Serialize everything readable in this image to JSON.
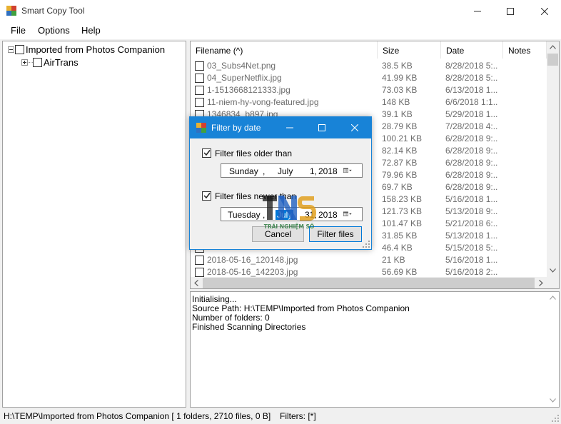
{
  "window": {
    "title": "Smart Copy Tool"
  },
  "menu": [
    "File",
    "Options",
    "Help"
  ],
  "tree": {
    "items": [
      {
        "label": "Imported from Photos Companion",
        "expanded": true
      },
      {
        "label": "AirTrans",
        "expanded": false
      }
    ]
  },
  "list": {
    "columns": [
      "Filename (^)",
      "Size",
      "Date",
      "Notes"
    ],
    "rows": [
      {
        "name": "03_Subs4Net.png",
        "size": "38.5 KB",
        "date": "8/28/2018 5:..."
      },
      {
        "name": "04_SuperNetflix.jpg",
        "size": "41.99 KB",
        "date": "8/28/2018 5:..."
      },
      {
        "name": "1-1513668121333.jpg",
        "size": "73.03 KB",
        "date": "6/13/2018 1..."
      },
      {
        "name": "11-niem-hy-vong-featured.jpg",
        "size": "148 KB",
        "date": "6/6/2018 1:1..."
      },
      {
        "name": "1346834_b897.jpg",
        "size": "39.1 KB",
        "date": "5/29/2018 1..."
      },
      {
        "name": "",
        "size": "28.79 KB",
        "date": "7/28/2018 4:..."
      },
      {
        "name": "",
        "size": "100.21 KB",
        "date": "6/28/2018 9:..."
      },
      {
        "name": "",
        "size": "82.14 KB",
        "date": "6/28/2018 9:..."
      },
      {
        "name": "",
        "size": "72.87 KB",
        "date": "6/28/2018 9:..."
      },
      {
        "name": "",
        "size": "79.96 KB",
        "date": "6/28/2018 9:..."
      },
      {
        "name": "",
        "size": "69.7 KB",
        "date": "6/28/2018 9:..."
      },
      {
        "name": "",
        "size": "158.23 KB",
        "date": "5/16/2018 1..."
      },
      {
        "name": "",
        "size": "121.73 KB",
        "date": "5/13/2018 9:..."
      },
      {
        "name": "",
        "size": "101.47 KB",
        "date": "5/21/2018 6:..."
      },
      {
        "name": "",
        "size": "31.85 KB",
        "date": "5/13/2018 1..."
      },
      {
        "name": "",
        "size": "46.4 KB",
        "date": "5/15/2018 5:..."
      },
      {
        "name": "2018-05-16_120148.jpg",
        "size": "21 KB",
        "date": "5/16/2018 1..."
      },
      {
        "name": "2018-05-16_142203.jpg",
        "size": "56.69 KB",
        "date": "5/16/2018 2:..."
      }
    ]
  },
  "log": {
    "lines": [
      "Initialising...",
      "Source Path: H:\\TEMP\\Imported from Photos Companion",
      "Number of folders: 0",
      "Finished Scanning Directories"
    ]
  },
  "status": {
    "path": "H:\\TEMP\\Imported from Photos Companion [ 1 folders, 2710 files, 0 B]",
    "filters": "Filters: [*]"
  },
  "dialog": {
    "title": "Filter by date",
    "older": {
      "label": "Filter files older than",
      "checked": true,
      "weekday": "Sunday",
      "month": "July",
      "day": "1,",
      "year": "2018"
    },
    "newer": {
      "label": "Filter files newer than",
      "checked": true,
      "weekday": "Tuesday",
      "month": "July",
      "day": "31,",
      "year": "2018"
    },
    "cancel_label": "Cancel",
    "filter_label": "Filter files"
  },
  "watermark": {
    "text": "TRẢI NGHIỆM SỐ"
  },
  "colors": {
    "accent": "#1883d7",
    "selection": "#0078d7"
  }
}
